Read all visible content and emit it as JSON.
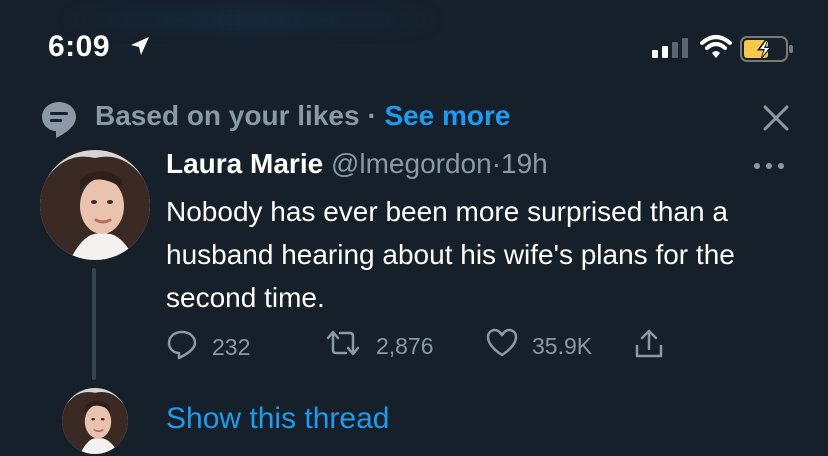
{
  "status_bar": {
    "time": "6:09",
    "icons": [
      "location-arrow-icon",
      "cellular-signal-icon",
      "wifi-icon",
      "battery-charging-icon"
    ]
  },
  "social_context": {
    "text": "Based on your likes",
    "separator": "·",
    "link": "See more",
    "icon": "speech-bubble-icon"
  },
  "tweet": {
    "author_name": "Laura Marie",
    "handle": "@lmegordon",
    "dot": "·",
    "time": "19h",
    "body": "Nobody has ever been more surprised than a husband hearing about his wife's plans for the second time.",
    "actions": {
      "replies": "232",
      "retweets": "2,876",
      "likes": "35.9K"
    }
  },
  "thread": {
    "show_label": "Show this thread"
  },
  "colors": {
    "background": "#15202b",
    "accent": "#1d9bf0",
    "secondary_text": "#8b98a5",
    "battery": "#f7c948"
  }
}
